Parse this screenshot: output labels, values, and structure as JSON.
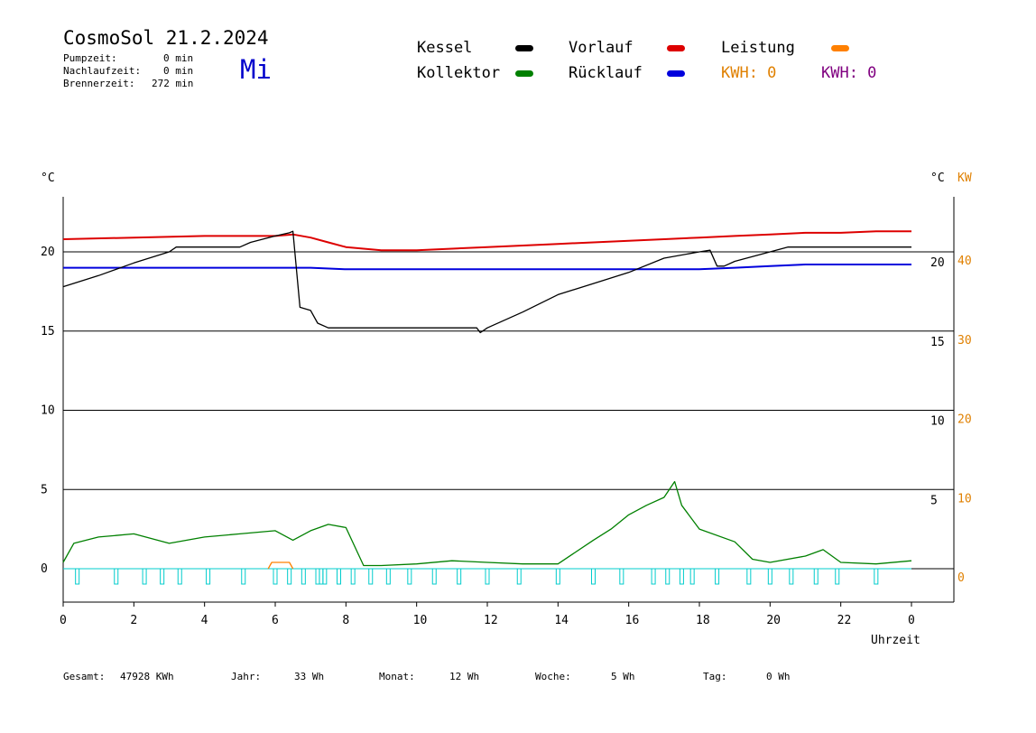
{
  "header": {
    "title": "CosmoSol 21.2.2024",
    "day": "Mi",
    "stats": [
      {
        "label": "Pumpzeit:",
        "value": "0 min"
      },
      {
        "label": "Nachlaufzeit:",
        "value": "0 min"
      },
      {
        "label": "Brennerzeit:",
        "value": "272 min"
      }
    ]
  },
  "legend": {
    "kessel": {
      "label": "Kessel",
      "color": "#000000"
    },
    "vorlauf": {
      "label": "Vorlauf",
      "color": "#dd0000"
    },
    "leistung": {
      "label": "Leistung",
      "color": "#ff8000"
    },
    "kollektor": {
      "label": "Kollektor",
      "color": "#008000"
    },
    "ruecklauf": {
      "label": "Rücklauf",
      "color": "#0000dd"
    },
    "kwh1": {
      "label": "KWH: 0",
      "color": "#e08000"
    },
    "kwh2": {
      "label": "KWH: 0",
      "color": "#800080"
    }
  },
  "footer": [
    {
      "label": "Gesamt:",
      "value": "47928 KWh"
    },
    {
      "label": "Jahr:",
      "value": "33 Wh"
    },
    {
      "label": "Monat:",
      "value": "12 Wh"
    },
    {
      "label": "Woche:",
      "value": "5 Wh"
    },
    {
      "label": "Tag:",
      "value": "0 Wh"
    }
  ],
  "chart_data": {
    "type": "line",
    "title": "CosmoSol 21.2.2024",
    "xlabel": "Uhrzeit",
    "ylabel_left": "°C",
    "ylabel_right": "°C",
    "ylabel_right2": "KW",
    "xlim": [
      0,
      24
    ],
    "ylim": [
      -2,
      23.5
    ],
    "y2lim": [
      -4,
      47
    ],
    "x_ticks": [
      "0",
      "2",
      "4",
      "6",
      "8",
      "10",
      "12",
      "14",
      "16",
      "18",
      "20",
      "22",
      "0"
    ],
    "y_left_ticks": [
      "0",
      "5",
      "10",
      "15",
      "20"
    ],
    "y_right_ticks": [
      "5",
      "10",
      "15",
      "20"
    ],
    "y2_ticks": [
      "0",
      "10",
      "20",
      "30",
      "40"
    ],
    "grid": true,
    "series": [
      {
        "name": "Vorlauf",
        "color": "#dd0000",
        "x": [
          0,
          2,
          4,
          6,
          6.5,
          7,
          7.5,
          8,
          8.5,
          9,
          10,
          11,
          12,
          13,
          14,
          15,
          16,
          17,
          18,
          19,
          20,
          21,
          22,
          23,
          24
        ],
        "y": [
          20.8,
          20.9,
          21.0,
          21.0,
          21.1,
          20.9,
          20.6,
          20.3,
          20.2,
          20.1,
          20.1,
          20.2,
          20.3,
          20.4,
          20.5,
          20.6,
          20.7,
          20.8,
          20.9,
          21.0,
          21.1,
          21.2,
          21.2,
          21.3,
          21.3
        ]
      },
      {
        "name": "Rücklauf",
        "color": "#0000dd",
        "x": [
          0,
          2,
          4,
          6,
          7,
          8,
          10,
          12,
          14,
          16,
          18,
          19,
          20,
          21,
          22,
          23,
          24
        ],
        "y": [
          19.0,
          19.0,
          19.0,
          19.0,
          19.0,
          18.9,
          18.9,
          18.9,
          18.9,
          18.9,
          18.9,
          19.0,
          19.1,
          19.2,
          19.2,
          19.2,
          19.2
        ]
      },
      {
        "name": "Kessel",
        "color": "#000000",
        "x": [
          0,
          1,
          2,
          3,
          3.2,
          5,
          5.3,
          6,
          6.4,
          6.5,
          6.7,
          7.0,
          7.2,
          7.5,
          8,
          10,
          11.7,
          11.8,
          12,
          13,
          14,
          15,
          16,
          17,
          18,
          18.3,
          18.5,
          18.7,
          19,
          20,
          20.5,
          21,
          22,
          23,
          24
        ],
        "y": [
          17.8,
          18.5,
          19.3,
          20.0,
          20.3,
          20.3,
          20.6,
          21.0,
          21.2,
          21.3,
          16.5,
          16.3,
          15.5,
          15.2,
          15.2,
          15.2,
          15.2,
          14.9,
          15.2,
          16.2,
          17.3,
          18.0,
          18.7,
          19.6,
          20.0,
          20.1,
          19.1,
          19.1,
          19.4,
          20.0,
          20.3,
          20.3,
          20.3,
          20.3,
          20.3
        ]
      },
      {
        "name": "Kollektor",
        "color": "#008000",
        "x": [
          0,
          0.3,
          1,
          2,
          3,
          4,
          5,
          6,
          6.5,
          7,
          7.5,
          8,
          8.5,
          9,
          10,
          11,
          12,
          13,
          14,
          15,
          15.5,
          16,
          16.5,
          17,
          17.3,
          17.5,
          18,
          19,
          19.5,
          20,
          21,
          21.5,
          22,
          23,
          24
        ],
        "y": [
          0.4,
          1.6,
          2.0,
          2.2,
          1.6,
          2.0,
          2.2,
          2.4,
          1.8,
          2.4,
          2.8,
          2.6,
          0.2,
          0.2,
          0.3,
          0.5,
          0.4,
          0.3,
          0.3,
          1.8,
          2.5,
          3.4,
          4.0,
          4.5,
          5.5,
          4.0,
          2.5,
          1.7,
          0.6,
          0.4,
          0.8,
          1.2,
          0.4,
          0.3,
          0.5
        ]
      },
      {
        "name": "Leistung",
        "color": "#ff8000",
        "x": [
          5.8,
          5.9,
          6.4,
          6.5
        ],
        "y": [
          0,
          0.4,
          0.4,
          0
        ]
      }
    ],
    "pump_pulses_x": [
      0.4,
      1.5,
      2.3,
      2.8,
      3.3,
      4.1,
      5.1,
      6.0,
      6.4,
      6.8,
      7.2,
      7.3,
      7.4,
      7.8,
      8.2,
      8.7,
      9.2,
      9.8,
      10.5,
      11.2,
      12.0,
      12.9,
      14.0,
      15.0,
      15.8,
      16.7,
      17.1,
      17.5,
      17.8,
      18.5,
      19.4,
      20.0,
      20.6,
      21.3,
      21.9,
      23.0
    ]
  }
}
